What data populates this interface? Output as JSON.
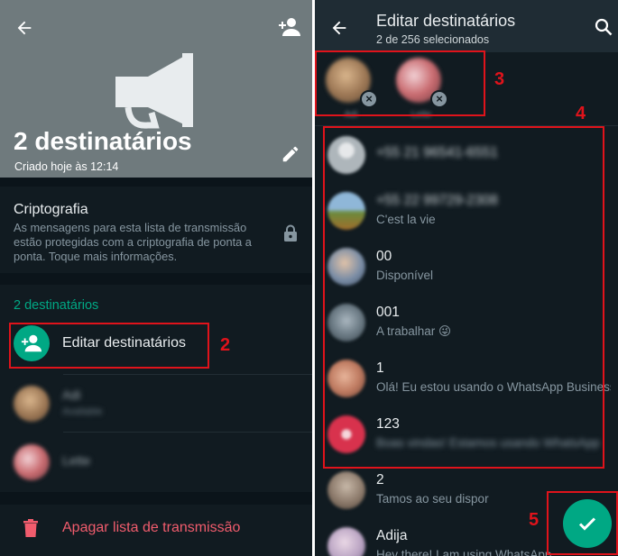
{
  "left_panel": {
    "title": "2 destinatários",
    "created": "Criado hoje às 12:14",
    "crypto": {
      "heading": "Criptografia",
      "text": "As mensagens para esta lista de transmissão estão protegidas com a criptografia de ponta a ponta. Toque mais informações."
    },
    "recipients_count": "2 destinatários",
    "edit_label": "Editar destinatários",
    "members": [
      {
        "name": "Adi",
        "status": "Available"
      },
      {
        "name": "Lette",
        "status": ""
      }
    ],
    "delete_label": "Apagar lista de transmissão"
  },
  "right_panel": {
    "title": "Editar destinatários",
    "subtitle": "2 de 256 selecionados",
    "selected": [
      {
        "name": "Adi"
      },
      {
        "name": "Lette"
      }
    ],
    "contacts": [
      {
        "name": "+55 21 96541-6551",
        "status": ""
      },
      {
        "name": "+55 22 99729-2308",
        "status": "C'est la vie"
      },
      {
        "name": "00",
        "status": "Disponível"
      },
      {
        "name": "001",
        "status": "A trabalhar 😜"
      },
      {
        "name": "1",
        "status": "Olá! Eu estou usando o WhatsApp Business."
      },
      {
        "name": "123",
        "status": "Boas vindas! Estamos usando WhatsApp"
      },
      {
        "name": "2",
        "status": "Tamos ao seu dispor"
      },
      {
        "name": "Adija",
        "status": "Hey there! I am using WhatsApp."
      }
    ]
  },
  "annotations": [
    "2",
    "3",
    "4",
    "5"
  ],
  "colors": {
    "accent": "#00a884",
    "danger": "#f15c6d",
    "annotation": "#e0131b"
  }
}
